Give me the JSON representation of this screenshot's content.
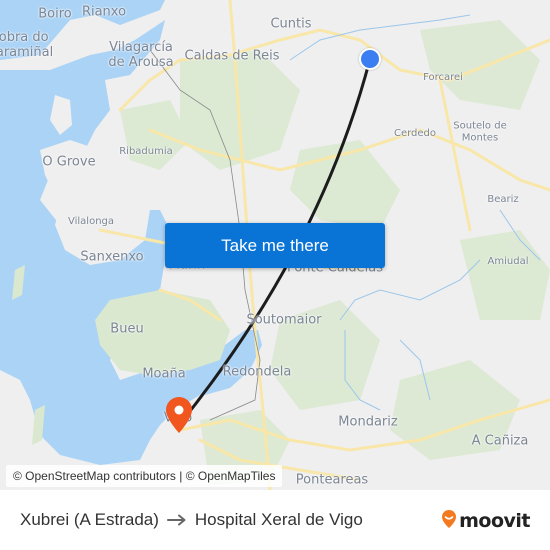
{
  "map": {
    "places": [
      {
        "name": "Boiro",
        "size": "lg"
      },
      {
        "name": "Rianxo",
        "size": "lg"
      },
      {
        "name": "Pobra do\nCaramiñal",
        "size": "lg"
      },
      {
        "name": "Vilagarcía\nde Arousa",
        "size": "lg"
      },
      {
        "name": "Cuntis",
        "size": "lg"
      },
      {
        "name": "Caldas de Reis",
        "size": "lg"
      },
      {
        "name": "Forcarei",
        "size": "sm"
      },
      {
        "name": "Cerdedo",
        "size": "sm"
      },
      {
        "name": "Soutelo de\nMontes",
        "size": "sm"
      },
      {
        "name": "Ribadumia",
        "size": "sm"
      },
      {
        "name": "O Grove",
        "size": "lg"
      },
      {
        "name": "Vilalonga",
        "size": "sm"
      },
      {
        "name": "Beariz",
        "size": "sm"
      },
      {
        "name": "Sanxenxo",
        "size": "lg"
      },
      {
        "name": "Amiudal",
        "size": "sm"
      },
      {
        "name": "Marín",
        "size": "lg"
      },
      {
        "name": "Ponte Caldelas",
        "size": "lg"
      },
      {
        "name": "Soutomaior",
        "size": "lg"
      },
      {
        "name": "Bueu",
        "size": "lg"
      },
      {
        "name": "Redondela",
        "size": "lg"
      },
      {
        "name": "Moaña",
        "size": "lg"
      },
      {
        "name": "Vigo",
        "size": "lg"
      },
      {
        "name": "Mondariz",
        "size": "lg"
      },
      {
        "name": "A Cañiza",
        "size": "lg"
      },
      {
        "name": "Ponteareas",
        "size": "lg"
      }
    ],
    "origin_marker": {
      "icon": "origin-dot-icon",
      "color": "#3a7ef2"
    },
    "destination_marker": {
      "icon": "destination-pin-icon",
      "color": "#f0561d"
    },
    "route_line_color": "#1c1c1c"
  },
  "cta": {
    "label": "Take me there",
    "color": "#0a74d6"
  },
  "attribution": "© OpenStreetMap contributors | © OpenMapTiles",
  "footer": {
    "origin": "Xubrei (A Estrada)",
    "arrow_icon": "arrow-right-icon",
    "destination": "Hospital Xeral de Vigo",
    "brand": "moovit",
    "brand_color": "#f47a20"
  }
}
